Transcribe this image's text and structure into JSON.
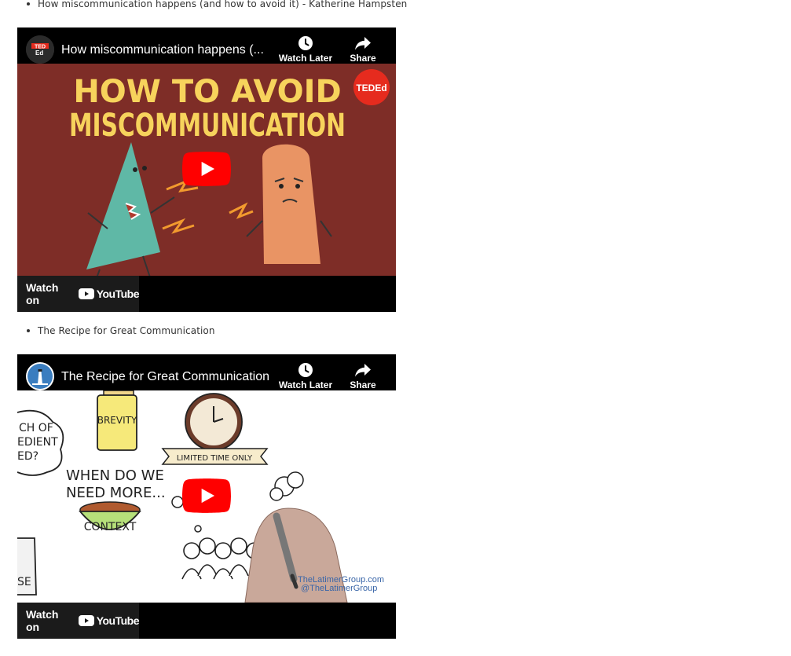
{
  "items": [
    {
      "bullet": "How miscommunication happens (and how to avoid it) - Katherine Hampsten",
      "video": {
        "title": "How miscommunication happens (...",
        "watch_later": "Watch Later",
        "share": "Share",
        "watch_on": "Watch on",
        "youtube": "YouTube",
        "channel_badge": "TED Ed",
        "corner_badge": "TEDEd",
        "headline_line1": "HOW TO AVOID",
        "headline_line2": "MISCOMMUNICATION"
      }
    },
    {
      "bullet": "The Recipe for Great Communication",
      "video": {
        "title": "The Recipe for Great Communication",
        "watch_later": "Watch Later",
        "share": "Share",
        "watch_on": "Watch on",
        "youtube": "YouTube",
        "labels": {
          "brevity": "BREVITY",
          "limited": "LIMITED TIME ONLY",
          "question_l1": "CH OF",
          "question_l2": "EDIENT",
          "question_l3": "ED?",
          "when_l1": "WHEN DO WE",
          "when_l2": "NEED MORE...",
          "context": "CONTEXT",
          "se": "SE",
          "site": "TheLatimerGroup.com",
          "handle": "@TheLatimerGroup"
        }
      }
    }
  ],
  "colors": {
    "ted_red": "#e62b1e",
    "headline_yellow": "#f7d35c",
    "thumb_bg_1": "#7e2d27",
    "youtube_red": "#ff0000"
  }
}
